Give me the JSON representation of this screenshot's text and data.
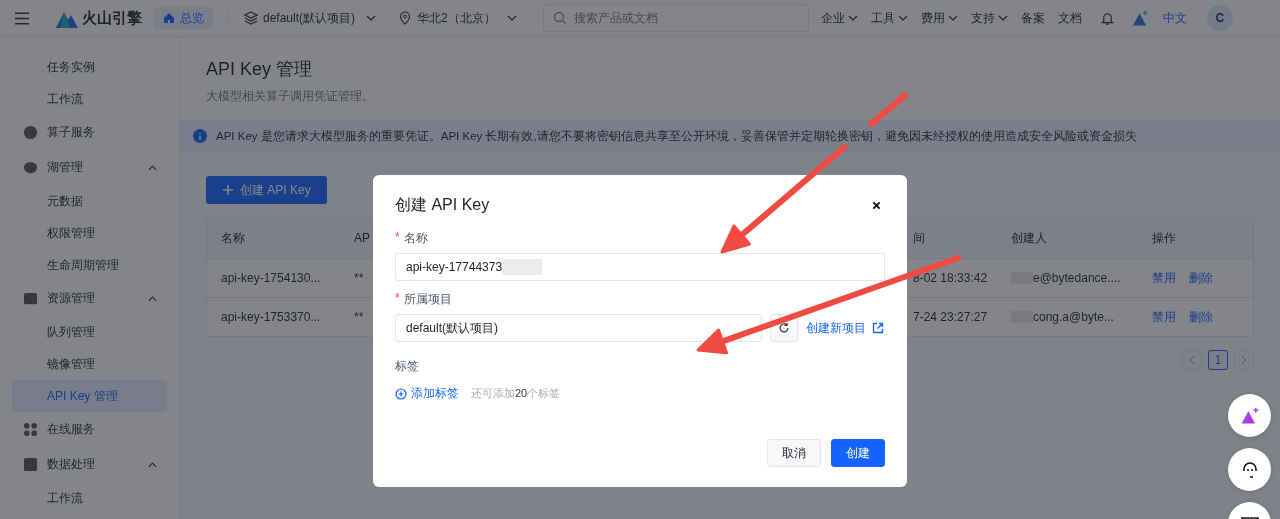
{
  "header": {
    "brand": "火山引擎",
    "home": {
      "label": "总览",
      "selected": true
    },
    "project": "default(默认项目)",
    "region": "华北2（北京）",
    "search": {
      "placeholder": "搜索产品或文档"
    },
    "nav": [
      {
        "label": "企业",
        "has_menu": true
      },
      {
        "label": "工具",
        "has_menu": true
      },
      {
        "label": "费用",
        "has_menu": true
      },
      {
        "label": "支持",
        "has_menu": true
      },
      {
        "label": "备案",
        "has_menu": false
      },
      {
        "label": "文档",
        "has_menu": false
      }
    ],
    "language": {
      "label": "中文",
      "selected": true
    },
    "avatar": "C"
  },
  "sidebar": {
    "items": [
      {
        "label": "任务实例",
        "kind": "sub",
        "selected": false
      },
      {
        "label": "工作流",
        "kind": "sub",
        "selected": false
      },
      {
        "label": "算子服务",
        "kind": "group",
        "selected": false
      },
      {
        "label": "湖管理",
        "kind": "group",
        "expanded": true,
        "selected": false
      },
      {
        "label": "元数据",
        "kind": "sub",
        "selected": false
      },
      {
        "label": "权限管理",
        "kind": "sub",
        "selected": false
      },
      {
        "label": "生命周期管理",
        "kind": "sub",
        "selected": false
      },
      {
        "label": "资源管理",
        "kind": "group",
        "expanded": true,
        "selected": false
      },
      {
        "label": "队列管理",
        "kind": "sub",
        "selected": false
      },
      {
        "label": "镜像管理",
        "kind": "sub",
        "selected": false
      },
      {
        "label": "API Key 管理",
        "kind": "sub",
        "selected": true
      },
      {
        "label": "在线服务",
        "kind": "group",
        "selected": false
      },
      {
        "label": "数据处理",
        "kind": "group",
        "expanded": true,
        "selected": false
      },
      {
        "label": "工作流",
        "kind": "sub",
        "selected": false
      }
    ]
  },
  "page": {
    "title": "API Key 管理",
    "subtitle": "大模型相关算子调用凭证管理。",
    "notice": "API Key 是您请求大模型服务的重要凭证。API Key 长期有效,请您不要将密钥信息共享至公开环境，妥善保管并定期轮换密钥，避免因未经授权的使用造成安全风险或资金损失",
    "create_button": "创建 API Key",
    "table": {
      "columns": [
        "名称",
        "AP",
        "间",
        "创建人",
        "操作"
      ],
      "rows": [
        {
          "name": "api-key-1754130...",
          "column_2": "**",
          "column_3": "8-02 18:33:42",
          "creator": "e@bytedance....",
          "actions": [
            "禁用",
            "删除"
          ]
        },
        {
          "name": "api-key-1753370...",
          "column_2": "**",
          "column_3": "7-24 23:27:27",
          "creator": "cong.a@byte...",
          "actions": [
            "禁用",
            "删除"
          ]
        }
      ]
    },
    "pagination": {
      "pages": [
        {
          "label": "1",
          "selected": true
        }
      ]
    }
  },
  "dialog": {
    "title": "创建 API Key",
    "fields": [
      {
        "label": "名称",
        "required_mark": "*",
        "kind": "input",
        "value": "api-key-17744373",
        "redacted": true
      },
      {
        "label": "所属项目",
        "required_mark": "*",
        "kind": "select",
        "value": "default(默认项目)",
        "link": "创建新项目"
      }
    ],
    "tags": {
      "label": "标签",
      "add": "添加标签",
      "hint": "还可添加**20**个标签"
    },
    "buttons": [
      {
        "label": "取消",
        "primary": false
      },
      {
        "label": "创建",
        "primary": true
      }
    ]
  },
  "annotations": [
    {
      "kind": "arrow"
    },
    {
      "kind": "arrow"
    }
  ]
}
